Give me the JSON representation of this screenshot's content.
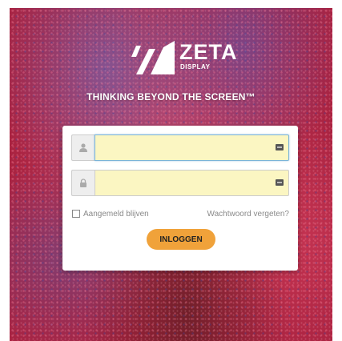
{
  "brand": {
    "word": "ZETA",
    "sub": "DISPLAY",
    "tagline": "THINKING BEYOND THE SCREEN™"
  },
  "login": {
    "username": {
      "value": "",
      "icon": "user-icon"
    },
    "password": {
      "value": "",
      "icon": "lock-icon"
    },
    "remember_label": "Aangemeld blijven",
    "forgot_label": "Wachtwoord vergeten?",
    "submit_label": "INLOGGEN"
  },
  "colors": {
    "accent": "#f0a23a",
    "input_autofill": "#fbf6c2",
    "background_primary": "#c8325a"
  }
}
